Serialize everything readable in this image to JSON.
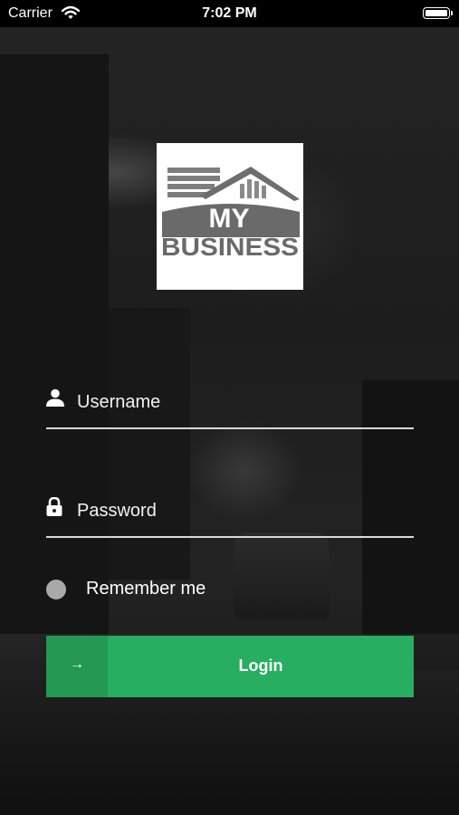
{
  "status_bar": {
    "carrier": "Carrier",
    "time": "7:02 PM"
  },
  "logo": {
    "line1": "MY",
    "line2": "BUSINESS"
  },
  "form": {
    "username_placeholder": "Username",
    "password_placeholder": "Password",
    "remember_label": "Remember me",
    "login_label": "Login",
    "login_arrow": "→"
  },
  "colors": {
    "accent": "#27ae60",
    "accent_dark": "#239953",
    "field_line": "#d9d9d9"
  },
  "icons": [
    "wifi-icon",
    "battery-icon",
    "user-icon",
    "lock-icon",
    "arrow-right-icon"
  ]
}
